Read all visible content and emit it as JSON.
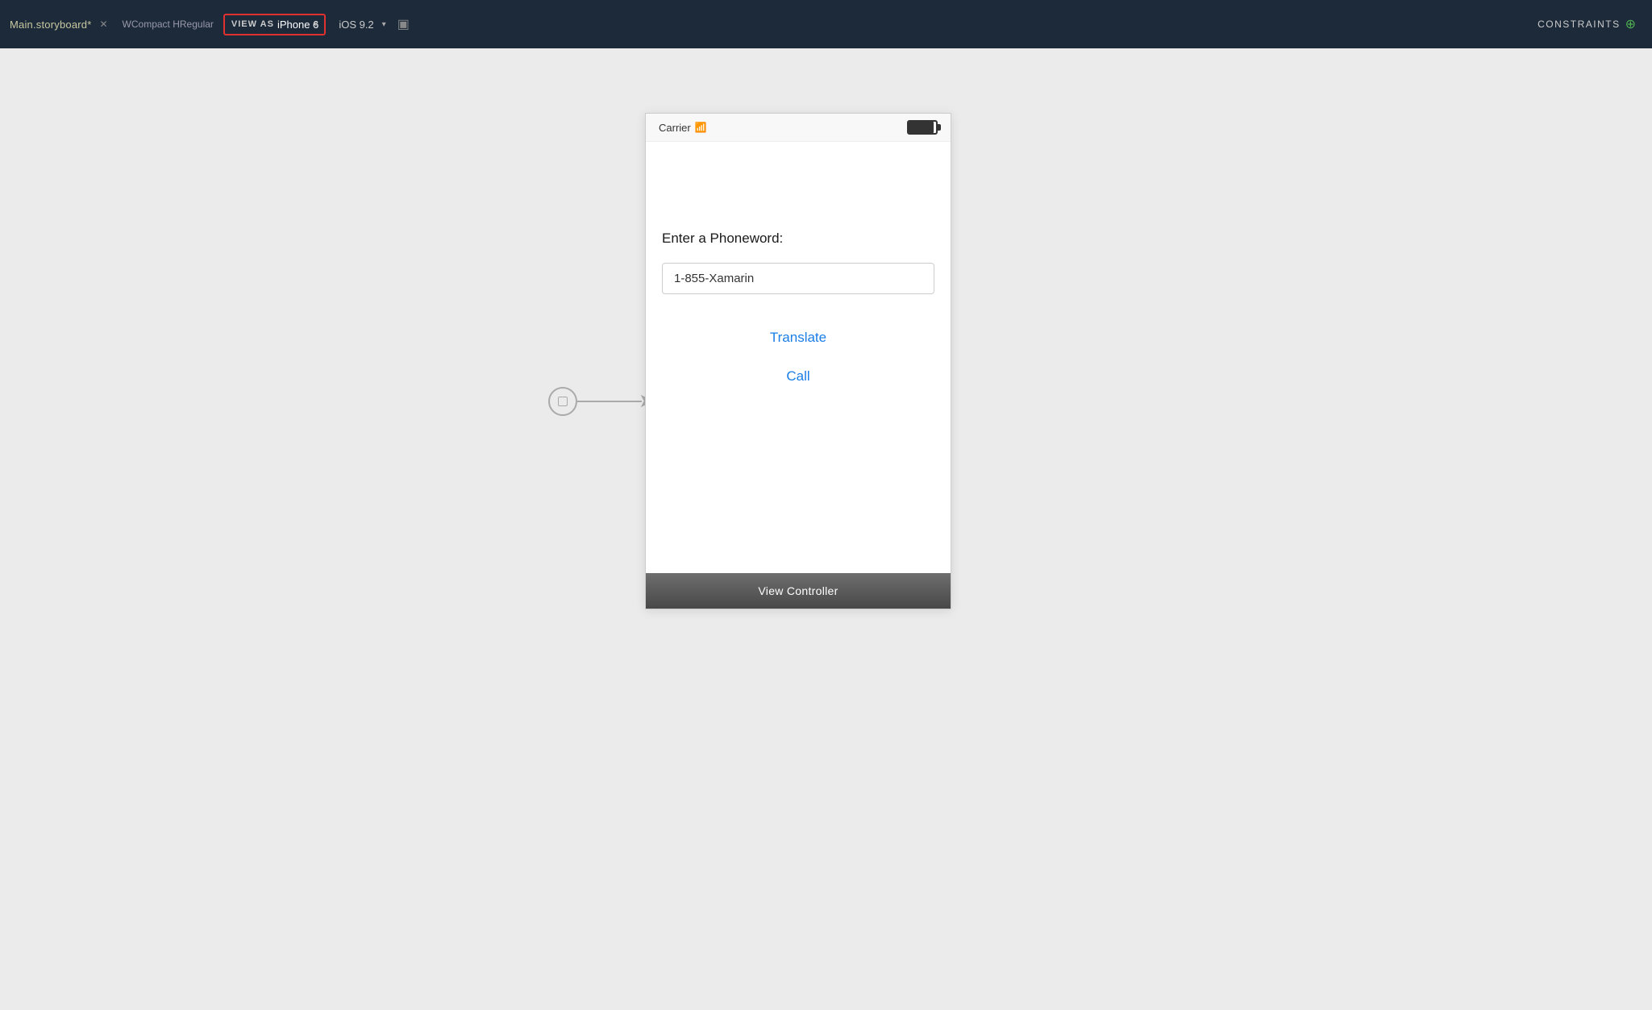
{
  "toolbar": {
    "tab_label": "Main.storyboard*",
    "view_as_label": "VIEW AS",
    "iphone_model": "iPhone 6",
    "ios_version": "iOS 9.2",
    "size_class": "WCompact HRegular",
    "constraints_label": "CONSTRAINTS"
  },
  "status_bar": {
    "carrier": "Carrier",
    "battery_icon": "battery"
  },
  "iphone_ui": {
    "phoneword_label": "Enter a Phoneword:",
    "input_value": "1-855-Xamarin",
    "translate_button": "Translate",
    "call_button": "Call"
  },
  "view_controller": {
    "label": "View Controller"
  },
  "connector": {
    "arrow": "→"
  }
}
